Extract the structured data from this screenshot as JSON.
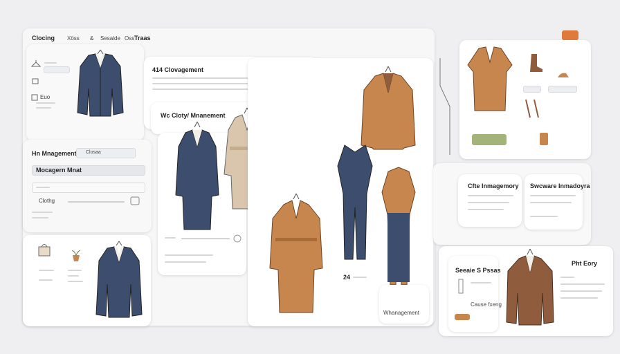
{
  "header": {
    "brand": "Clocing",
    "tabs": [
      "Xöss",
      "&",
      "Sesalde",
      "Oss",
      "Traas"
    ]
  },
  "left_panel": {
    "rows": [
      {
        "icon": "hanger-icon"
      },
      {
        "icon": "shirt-icon"
      },
      {
        "icon": "tag-icon",
        "label": "Euo"
      }
    ]
  },
  "mgmt_panel": {
    "title": "Hn Mnagement",
    "tab": "Closaa",
    "field_label": "Mocagern Mnat",
    "row_label": "Clothg"
  },
  "article": {
    "title": "414 Clovagement",
    "subtitle": "Wc Cloty/ Mnanement"
  },
  "outfit_panel": {
    "title": "Cfte Inmagemory",
    "subtitle": "Swcware Inmadoyra"
  },
  "bottom_right": {
    "title": "Seeaie S Pssas",
    "right_title": "Pht Eory",
    "item_label": "Cause fxeng"
  },
  "center_bottom": {
    "count": "24",
    "footer": "Whanagement"
  },
  "colors": {
    "navy": "#3c4d6e",
    "camel": "#c8864f",
    "tan": "#d9c6ad",
    "brown": "#8f5c3e",
    "accent": "#e07a3a",
    "green": "#a4b37a"
  }
}
